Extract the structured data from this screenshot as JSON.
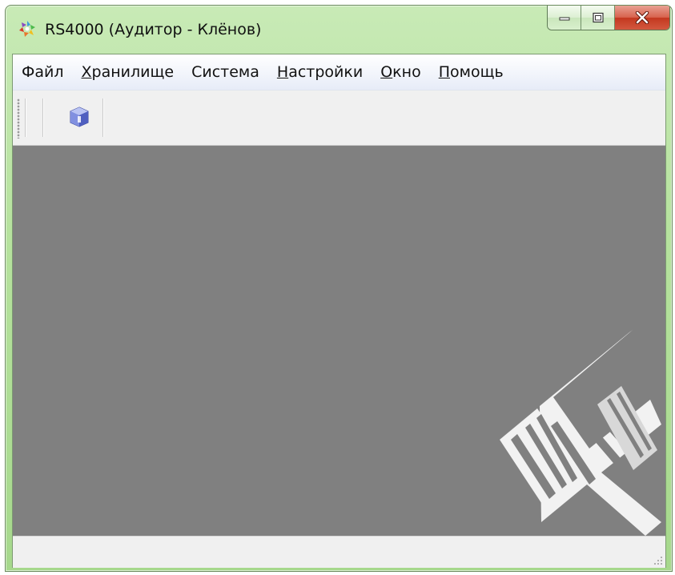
{
  "window": {
    "title": "RS4000 (Аудитор - Клёнов)",
    "frame_color": "#a6d88c",
    "close_color": "#c4381f"
  },
  "caption_buttons": {
    "minimize_icon": "minimize-icon",
    "maximize_icon": "maximize-icon",
    "close_icon": "close-icon"
  },
  "menu": {
    "items": [
      {
        "label": "Файл",
        "mnemonic": ""
      },
      {
        "label": "Хранилище",
        "mnemonic": "Х"
      },
      {
        "label": "Система",
        "mnemonic": ""
      },
      {
        "label": "Настройки",
        "mnemonic": "Н"
      },
      {
        "label": "Окно",
        "mnemonic": "О"
      },
      {
        "label": "Помощь",
        "mnemonic": "П"
      }
    ]
  },
  "toolbar": {
    "buttons": [
      {
        "icon": "storage-cube-icon"
      }
    ]
  },
  "workspace": {
    "background": "#808080",
    "watermark_icon": "rs4000-watermark-icon"
  },
  "statusbar": {
    "text": ""
  }
}
